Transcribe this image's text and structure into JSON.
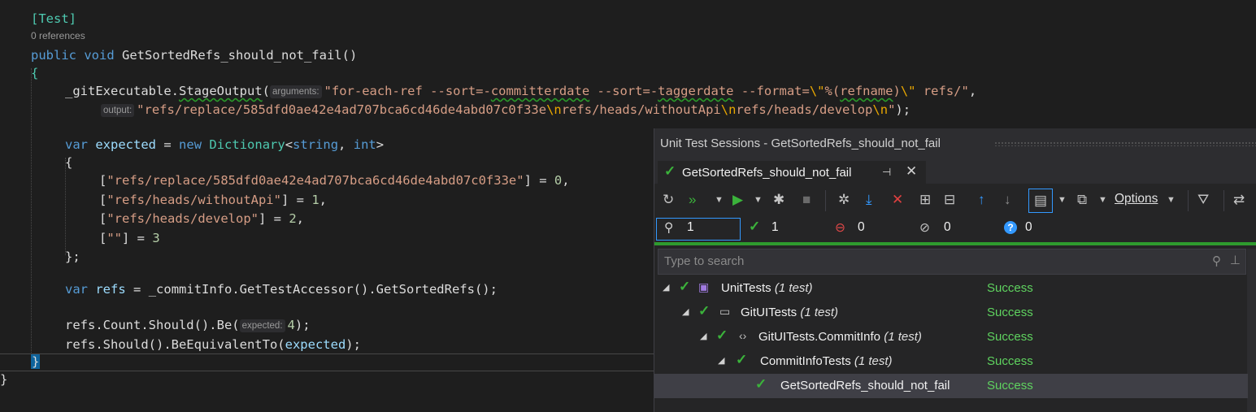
{
  "editor": {
    "attribute": "[Test]",
    "codelens": "0 references",
    "method_kw_public": "public",
    "method_kw_void": "void",
    "method_name": "GetSortedRefs_should_not_fail",
    "method_parens": "()",
    "open_brace": "{",
    "l1_obj": "_gitExecutable",
    "l1_method": "StageOutput",
    "l1_paren": "(",
    "hint_arguments": "arguments:",
    "l1_str_a": "\"for-each-ref --sort=-",
    "l1_str_b": "committerdate",
    "l1_str_c": " --sort=-",
    "l1_str_d": "taggerdate",
    "l1_str_e": " --format=",
    "l1_esc1": "\\\"",
    "l1_str_f": "%(",
    "l1_str_g": "refname",
    "l1_str_h": ")",
    "l1_esc2": "\\\"",
    "l1_str_i": " refs/\"",
    "l1_end": ",",
    "hint_output": "output:",
    "l2_str_a": "\"refs/replace/585dfd0ae42e4ad707bca6cd46de4abd07c0f33e",
    "l2_esc1": "\\n",
    "l2_str_b": "refs/heads/withoutApi",
    "l2_esc2": "\\n",
    "l2_str_c": "refs/heads/develop",
    "l2_esc3": "\\n",
    "l2_str_d": "\"",
    "l2_end": ");",
    "var_kw": "var",
    "expected_name": "expected",
    "eq": "=",
    "new_kw": "new",
    "dict_type": "Dictionary",
    "lt": "<",
    "string_kw": "string",
    "comma": ",",
    "int_kw": "int",
    "gt": ">",
    "inner_open": "{",
    "d1_key": "\"refs/replace/585dfd0ae42e4ad707bca6cd46de4abd07c0f33e\"",
    "d1_val": "0",
    "d2_key": "\"refs/heads/withoutApi\"",
    "d2_val": "1",
    "d3_key": "\"refs/heads/develop\"",
    "d3_val": "2",
    "d4_key": "\"\"",
    "d4_val": "3",
    "inner_close": "};",
    "refs_name": "refs",
    "refs_rhs": "_commitInfo.GetTestAccessor().GetSortedRefs();",
    "count_line": "refs.Count.Should().Be(",
    "hint_expected": "expected:",
    "count_val": "4",
    "count_end": ");",
    "equiv_line": "refs.Should().BeEquivalentTo(",
    "equiv_arg": "expected",
    "equiv_end": ");",
    "close_brace": "}",
    "outer_close": "}"
  },
  "panel": {
    "title": "Unit Test Sessions - GetSortedRefs_should_not_fail",
    "tab_label": "GetSortedRefs_should_not_fail",
    "options_label": "Options",
    "counters": {
      "total": "1",
      "passed": "1",
      "failed": "0",
      "ignored": "0",
      "unknown": "0"
    },
    "search_placeholder": "Type to search",
    "tree": [
      {
        "label": "UnitTests",
        "count": "(1 test)",
        "status": "Success"
      },
      {
        "label": "GitUITests",
        "count": "(1 test)",
        "status": "Success"
      },
      {
        "label": "GitUITests.CommitInfo",
        "count": "(1 test)",
        "status": "Success"
      },
      {
        "label": "CommitInfoTests",
        "count": "(1 test)",
        "status": "Success"
      },
      {
        "label": "GetSortedRefs_should_not_fail",
        "count": "",
        "status": "Success"
      }
    ]
  },
  "colors": {
    "keyword": "#569cd6",
    "type": "#4ec9b0",
    "string": "#d69d85",
    "success": "#5fd35f",
    "accent": "#3399ff"
  }
}
